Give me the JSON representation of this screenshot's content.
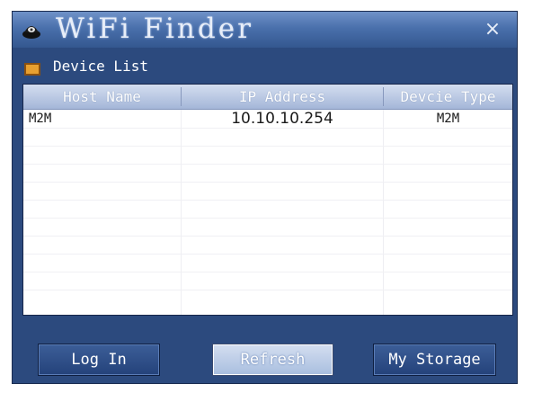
{
  "window": {
    "title": "WiFi Finder",
    "close_symbol": "×"
  },
  "section": {
    "label": "Device List"
  },
  "table": {
    "columns": [
      "Host Name",
      "IP Address",
      "Devcie Type"
    ],
    "rows": [
      {
        "host_name": "M2M",
        "ip_address": "10.10.10.254",
        "device_type": "M2M"
      }
    ]
  },
  "buttons": {
    "login": "Log In",
    "refresh": "Refresh",
    "storage": "My Storage"
  },
  "icons": {
    "app": "wifi-router-icon",
    "section": "folder-icon",
    "close": "close-icon"
  }
}
